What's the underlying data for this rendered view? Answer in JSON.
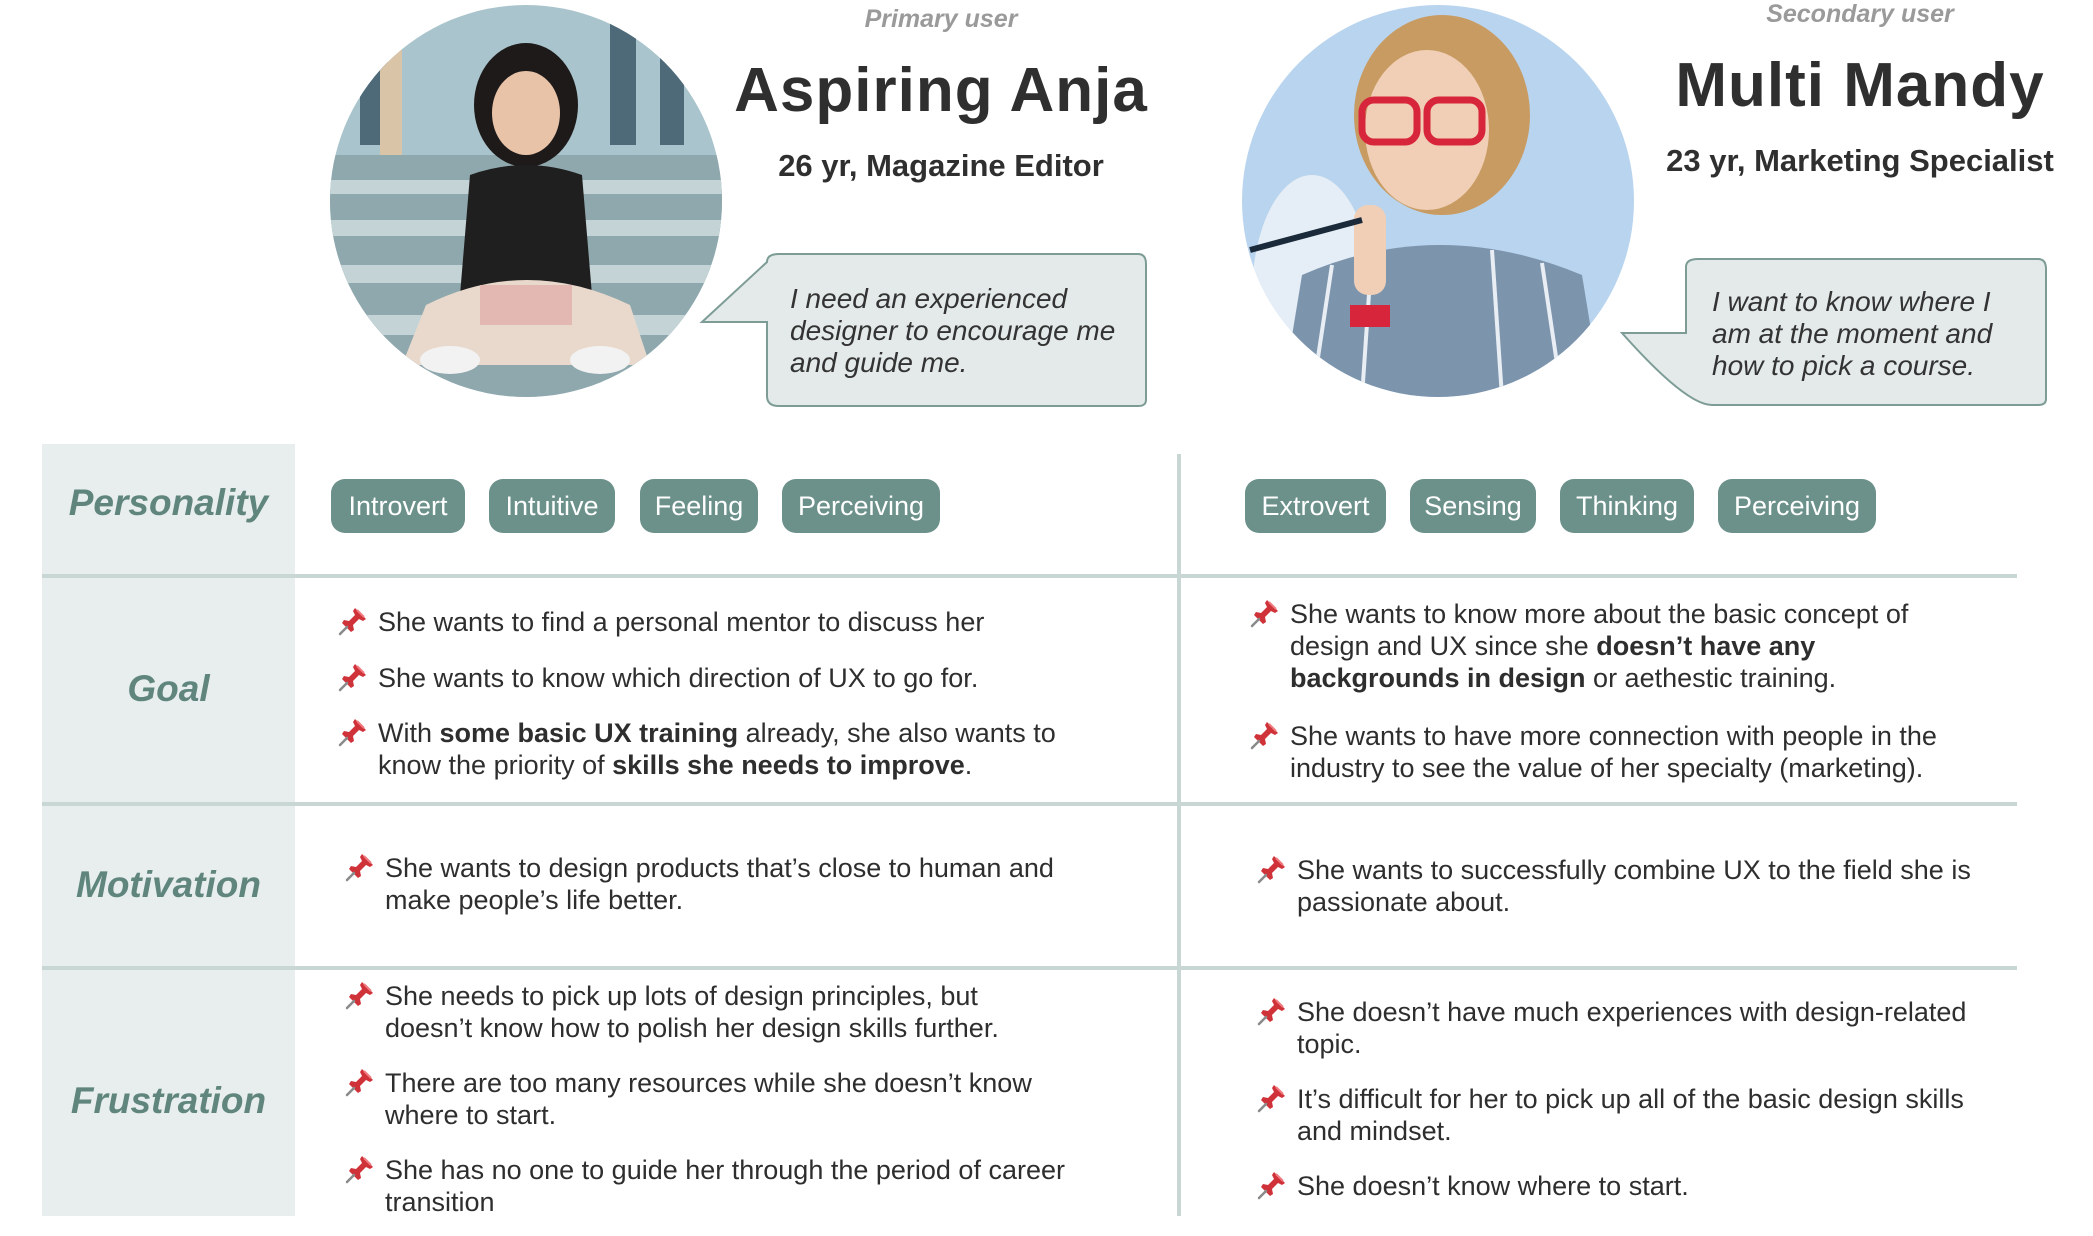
{
  "personas": [
    {
      "role": "Primary user",
      "name": "Aspiring Anja",
      "info": "26 yr, Magazine Editor",
      "quote": [
        "I need an experienced",
        "designer to encourage me",
        "and guide me."
      ],
      "traits": [
        "Introvert",
        "Intuitive",
        "Feeling",
        "Perceiving"
      ],
      "goal": [
        [
          {
            "t": "She wants to find a personal mentor to discuss her"
          }
        ],
        [
          {
            "t": "She wants to know which direction of UX to go for."
          }
        ],
        [
          {
            "t": "With "
          },
          {
            "t": "some basic UX training",
            "b": true
          },
          {
            "t": " already, she also wants to"
          }
        ],
        [
          {
            "t": "know the priority of "
          },
          {
            "t": "skills she needs to improve",
            "b": true
          },
          {
            "t": "."
          }
        ]
      ],
      "motivation": [
        "She wants to design products that’s close to human and",
        "make people’s life better."
      ],
      "frustration": [
        "She needs to pick up lots of design principles, but",
        "doesn’t know how to polish her design skills further.",
        "There are too many resources while she doesn’t know",
        "where to start.",
        "She has no one to guide her through the period of career",
        "transition"
      ]
    },
    {
      "role": "Secondary user",
      "name": "Multi Mandy",
      "info": "23 yr, Marketing Specialist",
      "quote": [
        "I want to know where I",
        "am at the moment and",
        "how to pick a course."
      ],
      "traits": [
        "Extrovert",
        "Sensing",
        "Thinking",
        "Perceiving"
      ],
      "goal": [
        [
          {
            "t": "She wants to know more about the basic concept of"
          }
        ],
        [
          {
            "t": "design and UX since she "
          },
          {
            "t": "doesn’t have any",
            "b": true
          }
        ],
        [
          {
            "t": "backgrounds in design",
            "b": true
          },
          {
            "t": " or aethestic training."
          }
        ],
        [
          {
            "t": "She wants to have more connection with people in the"
          }
        ],
        [
          {
            "t": "industry to see the value of her specialty (marketing)."
          }
        ]
      ],
      "motivation": [
        "She wants to successfully combine UX to the field she is",
        "passionate about."
      ],
      "frustration": [
        "She doesn’t have much experiences with design-related",
        "topic.",
        "It’s difficult for her to pick up all of the basic design skills",
        "and mindset.",
        "She doesn’t know where to start."
      ]
    }
  ],
  "rows": {
    "personality": "Personality",
    "goal": "Goal",
    "motivation": "Motivation",
    "frustration": "Frustration"
  },
  "colors": {
    "accent": "#6b918a",
    "label_bg": "#e7eeed",
    "label_text": "#5f857c",
    "divider": "#c9d7d4",
    "pin": "#d0323a"
  },
  "icons": {
    "bullet": "pushpin-icon"
  }
}
